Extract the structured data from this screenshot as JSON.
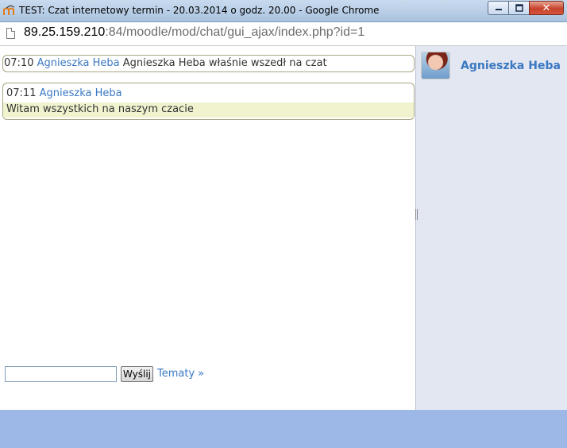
{
  "window": {
    "title": "TEST: Czat internetowy termin - 20.03.2014 o godz. 20.00 - Google Chrome",
    "close_glyph": "✕"
  },
  "address": {
    "host": "89.25.159.210",
    "rest": ":84/moodle/mod/chat/gui_ajax/index.php?id=1"
  },
  "messages": [
    {
      "time": "07:10",
      "user": "Agnieszka Heba",
      "text": "Agnieszka Heba właśnie wszedł na czat"
    },
    {
      "time": "07:11",
      "user": "Agnieszka Heba",
      "text": "Witam wszystkich na naszym czacie"
    }
  ],
  "users": [
    {
      "name": "Agnieszka Heba"
    }
  ],
  "compose": {
    "input_value": "",
    "send_label": "Wyślij",
    "themes_link": "Tematy »"
  },
  "colors": {
    "link": "#3a78c2",
    "userlist_bg": "#e3e7f1",
    "bottombar_bg": "#9db8e6",
    "highlight_line": "#f1f3cf"
  },
  "icons": {
    "app": "moodle-icon",
    "page": "document-icon"
  }
}
